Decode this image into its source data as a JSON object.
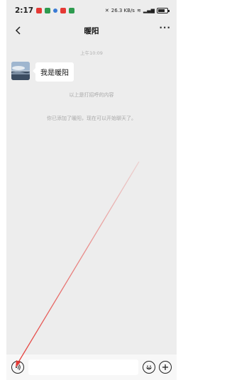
{
  "status_bar": {
    "time": "2:17",
    "signal_text": "26.3 KB/s"
  },
  "nav": {
    "title": "暖阳",
    "more": "···"
  },
  "chat": {
    "timestamp": "上午10:09",
    "message": {
      "sender_avatar": "avatar",
      "text": "我是暖阳"
    },
    "system_messages": [
      "以上是打招呼的内容",
      "你已添加了暖阳，现在可以开始聊天了。"
    ]
  },
  "input_bar": {
    "value": ""
  },
  "icons": {
    "back": "chevron-left-icon",
    "more": "more-dots-icon",
    "voice": "voice-icon",
    "emoji": "emoji-icon",
    "plus": "plus-icon"
  },
  "colors": {
    "chat_bg": "#ededed",
    "bubble_bg": "#ffffff",
    "annotation": "#e53935"
  }
}
